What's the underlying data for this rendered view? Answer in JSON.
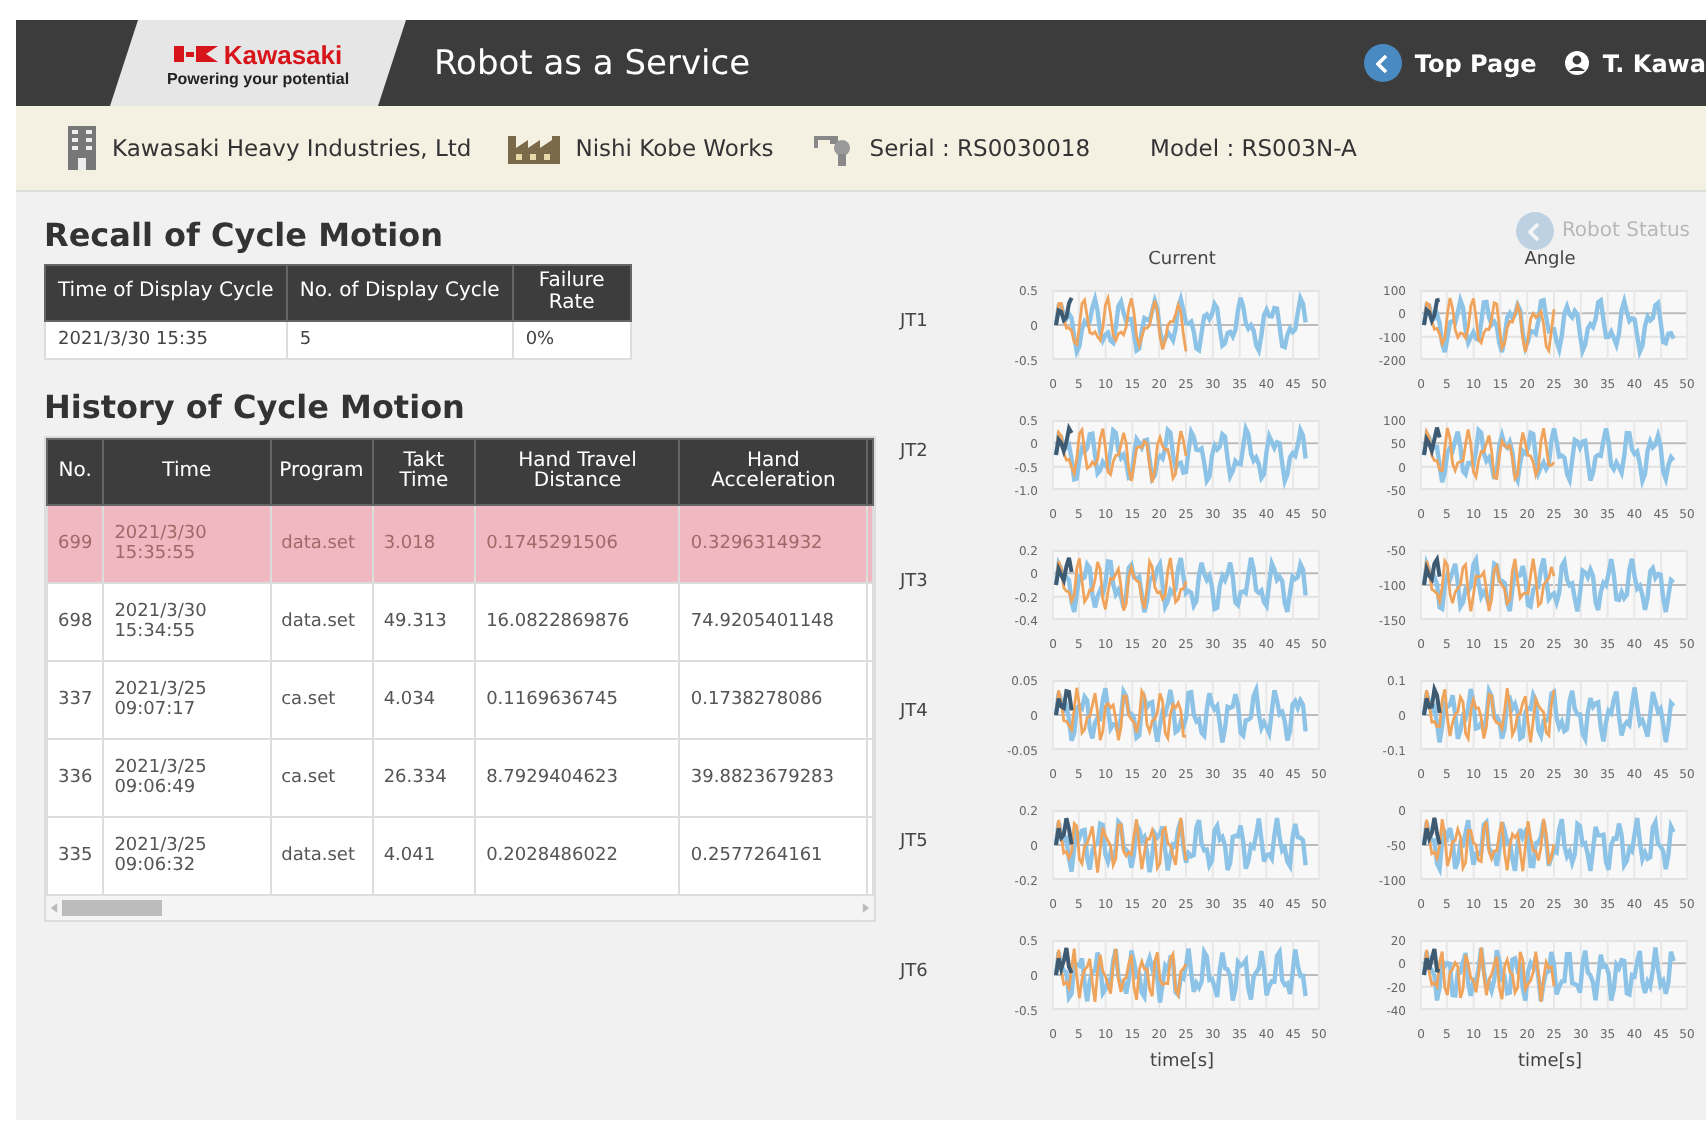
{
  "header": {
    "logo": {
      "brand": "Kawasaki",
      "tagline": "Powering your potential"
    },
    "title": "Robot as a Service",
    "top_page": "Top Page",
    "user": "T. Kawa"
  },
  "info_bar": {
    "company": "Kawasaki Heavy Industries, Ltd",
    "works": "Nishi Kobe Works",
    "serial": "Serial : RS0030018",
    "model": "Model : RS003N-A"
  },
  "recall": {
    "title": "Recall of Cycle Motion",
    "columns": [
      "Time of Display Cycle",
      "No. of Display Cycle",
      "Failure Rate"
    ],
    "row": [
      "2021/3/30 15:35",
      "5",
      "0%"
    ]
  },
  "history": {
    "title": "History of Cycle Motion",
    "columns": [
      "No.",
      "Time",
      "Program",
      "Takt Time",
      "Hand Travel Distance",
      "Hand Acceleration"
    ],
    "rows": [
      {
        "selected": true,
        "cells": [
          "699",
          "2021/3/30 15:35:55",
          "data.set",
          "3.018",
          "0.1745291506",
          "0.3296314932"
        ]
      },
      {
        "selected": false,
        "cells": [
          "698",
          "2021/3/30 15:34:55",
          "data.set",
          "49.313",
          "16.0822869876",
          "74.9205401148"
        ]
      },
      {
        "selected": false,
        "cells": [
          "337",
          "2021/3/25 09:07:17",
          "ca.set",
          "4.034",
          "0.1169636745",
          "0.1738278086"
        ]
      },
      {
        "selected": false,
        "cells": [
          "336",
          "2021/3/25 09:06:49",
          "ca.set",
          "26.334",
          "8.7929404623",
          "39.8823679283"
        ]
      },
      {
        "selected": false,
        "cells": [
          "335",
          "2021/3/25 09:06:32",
          "data.set",
          "4.041",
          "0.2028486022",
          "0.2577264161"
        ]
      }
    ]
  },
  "robot_status": {
    "label": "Robot Status",
    "disabled": true
  },
  "charts": {
    "column_titles": [
      "Current",
      "Angle"
    ],
    "xlabels": [
      "time[s]",
      "time[s]"
    ],
    "joints": [
      {
        "label": "JT1",
        "plots": [
          {
            "yticks": [
              "0.5",
              "0",
              "-0.5"
            ],
            "xticks": [
              "0",
              "5",
              "10",
              "15",
              "20",
              "25",
              "30",
              "35",
              "40",
              "45",
              "50"
            ]
          },
          {
            "yticks": [
              "100",
              "0",
              "-100",
              "-200"
            ],
            "xticks": [
              "0",
              "5",
              "10",
              "15",
              "20",
              "25",
              "30",
              "35",
              "40",
              "45",
              "50"
            ]
          }
        ]
      },
      {
        "label": "JT2",
        "plots": [
          {
            "yticks": [
              "0.5",
              "0",
              "-0.5",
              "-1.0"
            ],
            "xticks": [
              "0",
              "5",
              "10",
              "15",
              "20",
              "25",
              "30",
              "35",
              "40",
              "45",
              "50"
            ]
          },
          {
            "yticks": [
              "100",
              "50",
              "0",
              "-50"
            ],
            "xticks": [
              "0",
              "5",
              "10",
              "15",
              "20",
              "25",
              "30",
              "35",
              "40",
              "45",
              "50"
            ]
          }
        ]
      },
      {
        "label": "JT3",
        "plots": [
          {
            "yticks": [
              "0.2",
              "0",
              "-0.2",
              "-0.4"
            ],
            "xticks": [
              "0",
              "5",
              "10",
              "15",
              "20",
              "25",
              "30",
              "35",
              "40",
              "45",
              "50"
            ]
          },
          {
            "yticks": [
              "-50",
              "-100",
              "-150"
            ],
            "xticks": [
              "0",
              "5",
              "10",
              "15",
              "20",
              "25",
              "30",
              "35",
              "40",
              "45",
              "50"
            ]
          }
        ]
      },
      {
        "label": "JT4",
        "plots": [
          {
            "yticks": [
              "0.05",
              "0",
              "-0.05"
            ],
            "xticks": [
              "0",
              "5",
              "10",
              "15",
              "20",
              "25",
              "30",
              "35",
              "40",
              "45",
              "50"
            ]
          },
          {
            "yticks": [
              "0.1",
              "0",
              "-0.1"
            ],
            "xticks": [
              "0",
              "5",
              "10",
              "15",
              "20",
              "25",
              "30",
              "35",
              "40",
              "45",
              "50"
            ]
          }
        ]
      },
      {
        "label": "JT5",
        "plots": [
          {
            "yticks": [
              "0.2",
              "0",
              "-0.2"
            ],
            "xticks": [
              "0",
              "5",
              "10",
              "15",
              "20",
              "25",
              "30",
              "35",
              "40",
              "45",
              "50"
            ]
          },
          {
            "yticks": [
              "0",
              "-50",
              "-100"
            ],
            "xticks": [
              "0",
              "5",
              "10",
              "15",
              "20",
              "25",
              "30",
              "35",
              "40",
              "45",
              "50"
            ]
          }
        ]
      },
      {
        "label": "JT6",
        "plots": [
          {
            "yticks": [
              "0.5",
              "0",
              "-0.5"
            ],
            "xticks": [
              "0",
              "5",
              "10",
              "15",
              "20",
              "25",
              "30",
              "35",
              "40",
              "45",
              "50"
            ]
          },
          {
            "yticks": [
              "20",
              "0",
              "-20",
              "-40"
            ],
            "xticks": [
              "0",
              "5",
              "10",
              "15",
              "20",
              "25",
              "30",
              "35",
              "40",
              "45",
              "50"
            ]
          }
        ]
      }
    ]
  }
}
